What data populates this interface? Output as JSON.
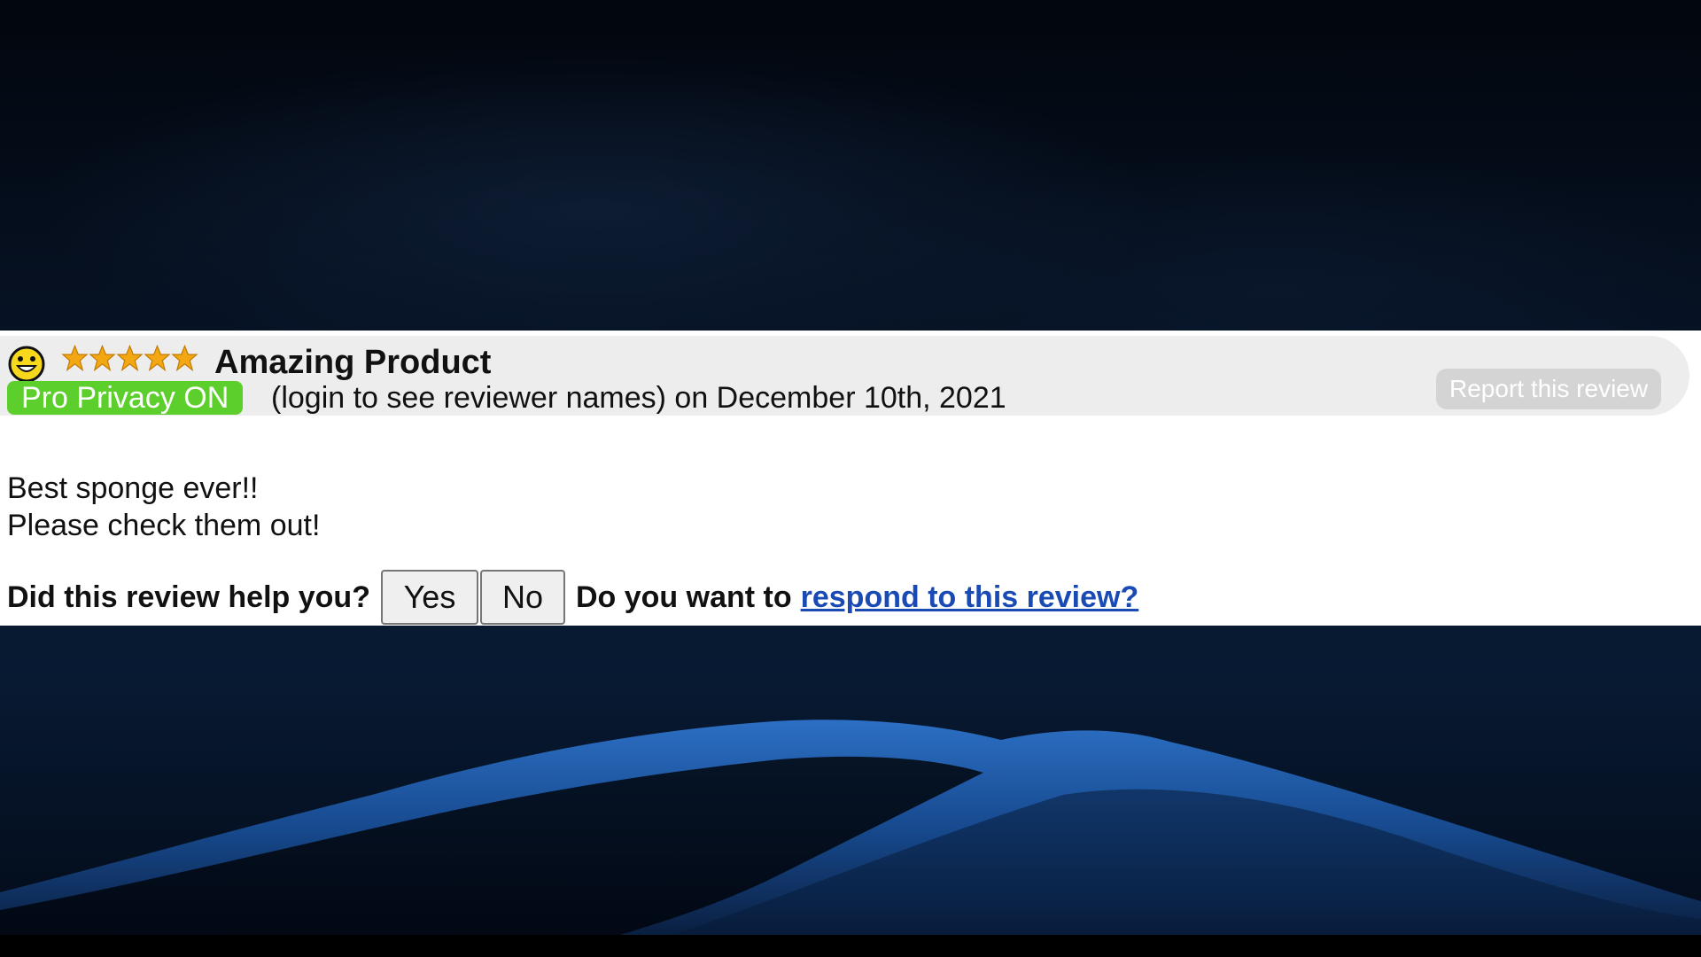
{
  "review": {
    "title": "Amazing Product",
    "rating": 5,
    "rating_max": 5,
    "mood_icon": "smiley-face-icon",
    "star_icon": "star-icon",
    "star_color": "#f3a712",
    "privacy_badge": "Pro Privacy ON",
    "privacy_badge_color": "#5ccf2c",
    "meta_text": "(login to see reviewer names) on December 10th, 2021",
    "report_label": "Report this review",
    "body_lines": [
      "Best sponge ever!!",
      "Please check them out!"
    ]
  },
  "feedback": {
    "question": "Did this review help you?",
    "yes_label": "Yes",
    "no_label": "No",
    "respond_prompt": "Do you want to",
    "respond_link": "respond to this review?",
    "link_color": "#1a4bb5"
  }
}
